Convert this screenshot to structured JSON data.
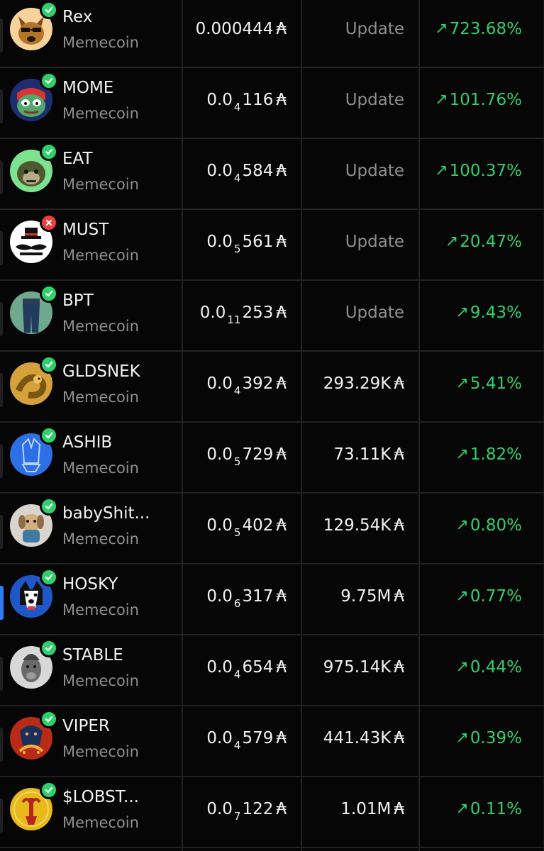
{
  "tokens": [
    {
      "name": "Rex",
      "subtitle": "Memecoin",
      "verified": true,
      "price_prefix": "0.000444",
      "price_subscript": "",
      "price_digits": "",
      "price_unit": "₳",
      "market_cap": "Update",
      "market_cap_unit": "",
      "change": "723.68%",
      "avatar": "dog-icon",
      "colors": {
        "bg": "#f3c17a",
        "fg": "#b57428"
      }
    },
    {
      "name": "MOME",
      "subtitle": "Memecoin",
      "verified": true,
      "price_prefix": "0.0",
      "price_subscript": "4",
      "price_digits": "116",
      "price_unit": "₳",
      "market_cap": "Update",
      "market_cap_unit": "",
      "change": "101.76%",
      "avatar": "frog-icon",
      "colors": {
        "bg": "#1d2d70",
        "fg": "#52a86d"
      }
    },
    {
      "name": "EAT",
      "subtitle": "Memecoin",
      "verified": true,
      "price_prefix": "0.0",
      "price_subscript": "4",
      "price_digits": "584",
      "price_unit": "₳",
      "market_cap": "Update",
      "market_cap_unit": "",
      "change": "100.37%",
      "avatar": "ape-icon",
      "colors": {
        "bg": "#7ce28f",
        "fg": "#2e3b20"
      }
    },
    {
      "name": "MUST",
      "subtitle": "Memecoin",
      "verified": false,
      "price_prefix": "0.0",
      "price_subscript": "5",
      "price_digits": "561",
      "price_unit": "₳",
      "market_cap": "Update",
      "market_cap_unit": "",
      "change": "20.47%",
      "avatar": "mustache-icon",
      "colors": {
        "bg": "#ffffff",
        "fg": "#1a1a1a"
      }
    },
    {
      "name": "BPT",
      "subtitle": "Memecoin",
      "verified": true,
      "price_prefix": "0.0",
      "price_subscript": "11",
      "price_digits": "253",
      "price_unit": "₳",
      "market_cap": "Update",
      "market_cap_unit": "",
      "change": "9.43%",
      "avatar": "pants-icon",
      "colors": {
        "bg": "#6ea98d",
        "fg": "#223b5c"
      }
    },
    {
      "name": "GLDSNEK",
      "subtitle": "Memecoin",
      "verified": true,
      "price_prefix": "0.0",
      "price_subscript": "4",
      "price_digits": "392",
      "price_unit": "₳",
      "market_cap": "293.29K",
      "market_cap_unit": "₳",
      "change": "5.41%",
      "avatar": "snake-icon",
      "colors": {
        "bg": "#d5a13a",
        "fg": "#7a5611"
      }
    },
    {
      "name": "ASHIB",
      "subtitle": "Memecoin",
      "verified": true,
      "price_prefix": "0.0",
      "price_subscript": "5",
      "price_digits": "729",
      "price_unit": "₳",
      "market_cap": "73.11K",
      "market_cap_unit": "₳",
      "change": "1.82%",
      "avatar": "shiba-icon",
      "colors": {
        "bg": "#2d6fe4",
        "fg": "#bdd3ff"
      }
    },
    {
      "name": "babyShit...",
      "subtitle": "Memecoin",
      "verified": true,
      "price_prefix": "0.0",
      "price_subscript": "5",
      "price_digits": "402",
      "price_unit": "₳",
      "market_cap": "129.54K",
      "market_cap_unit": "₳",
      "change": "0.80%",
      "avatar": "puppy-icon",
      "colors": {
        "bg": "#d9d5ce",
        "fg": "#8f6e45"
      }
    },
    {
      "name": "HOSKY",
      "subtitle": "Memecoin",
      "verified": true,
      "price_prefix": "0.0",
      "price_subscript": "6",
      "price_digits": "317",
      "price_unit": "₳",
      "market_cap": "9.75M",
      "market_cap_unit": "₳",
      "change": "0.77%",
      "avatar": "husky-icon",
      "colors": {
        "bg": "#1f57c9",
        "fg": "#ffffff"
      }
    },
    {
      "name": "STABLE",
      "subtitle": "Memecoin",
      "verified": true,
      "price_prefix": "0.0",
      "price_subscript": "4",
      "price_digits": "654",
      "price_unit": "₳",
      "market_cap": "975.14K",
      "market_cap_unit": "₳",
      "change": "0.44%",
      "avatar": "horse-icon",
      "colors": {
        "bg": "#d8d8d8",
        "fg": "#6a6a6a"
      }
    },
    {
      "name": "VIPER",
      "subtitle": "Memecoin",
      "verified": true,
      "price_prefix": "0.0",
      "price_subscript": "4",
      "price_digits": "579",
      "price_unit": "₳",
      "market_cap": "441.43K",
      "market_cap_unit": "₳",
      "change": "0.39%",
      "avatar": "viper-icon",
      "colors": {
        "bg": "#b92a17",
        "fg": "#f4b33d"
      }
    },
    {
      "name": "$LOBST...",
      "subtitle": "Memecoin",
      "verified": true,
      "price_prefix": "0.0",
      "price_subscript": "7",
      "price_digits": "122",
      "price_unit": "₳",
      "market_cap": "1.01M",
      "market_cap_unit": "₳",
      "change": "0.11%",
      "avatar": "lobster-icon",
      "colors": {
        "bg": "#e8b91c",
        "fg": "#b5251a"
      }
    }
  ]
}
